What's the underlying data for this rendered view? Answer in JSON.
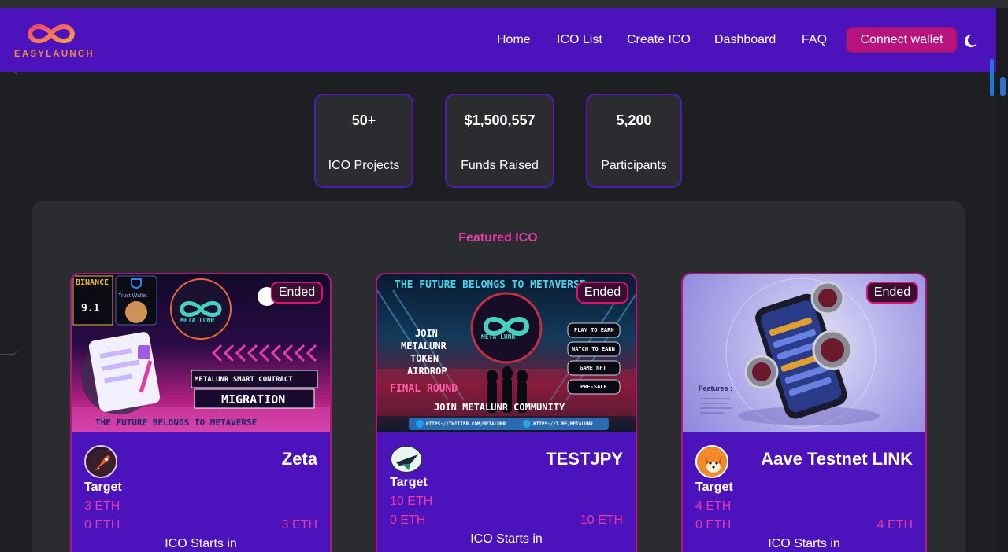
{
  "brand": {
    "name": "EASYLAUNCH"
  },
  "nav": {
    "links": [
      "Home",
      "ICO List",
      "Create ICO",
      "Dashboard",
      "FAQ"
    ],
    "connect_label": "Connect wallet",
    "theme_icon": "moon-icon"
  },
  "stats": [
    {
      "value": "50+",
      "label": "ICO Projects"
    },
    {
      "value": "$1,500,557",
      "label": "Funds Raised"
    },
    {
      "value": "5,200",
      "label": "Participants"
    }
  ],
  "featured": {
    "title": "Featured ICO",
    "cards": [
      {
        "name": "Zeta",
        "status": "Ended",
        "target_label": "Target",
        "target": "3 ETH",
        "raised": "0 ETH",
        "goal": "3 ETH",
        "starts_label": "ICO Starts in",
        "image": {
          "lines": [
            "BINANCE",
            "9.1",
            "Trust Wallet",
            "META LUNR",
            "METALUNR SMART CONTRACT",
            "MIGRATION",
            "THE FUTURE BELONGS TO METAVERSE"
          ]
        }
      },
      {
        "name": "TESTJPY",
        "status": "Ended",
        "target_label": "Target",
        "target": "10 ETH",
        "raised": "0 ETH",
        "goal": "10 ETH",
        "starts_label": "ICO Starts in",
        "image": {
          "lines": [
            "THE FUTURE BELONGS TO METAVERSE",
            "JOIN",
            "METALUNR",
            "TOKEN",
            "AIRDROP",
            "FINAL ROUND",
            "META LUNR",
            "PLAY TO EARN",
            "WATCH TO EARN",
            "GAME NFT",
            "PRE-SALE",
            "JOIN METALUNR COMMUNITY",
            "HTTPS://TWITTER.COM/METALUNR",
            "HTTPS://T.ME/METALUNR"
          ]
        }
      },
      {
        "name": "Aave Testnet LINK",
        "status": "Ended",
        "target_label": "Target",
        "target": "4 ETH",
        "raised": "0 ETH",
        "goal": "4 ETH",
        "starts_label": "ICO Starts in",
        "image": {
          "lines": [
            "Features :"
          ]
        }
      }
    ]
  },
  "colors": {
    "nav_bg": "#4c13bd",
    "accent_pink": "#e33aa4",
    "button_bg": "#b8137d",
    "page_bg": "#1e1f22",
    "panel_bg": "#2b2c30"
  }
}
